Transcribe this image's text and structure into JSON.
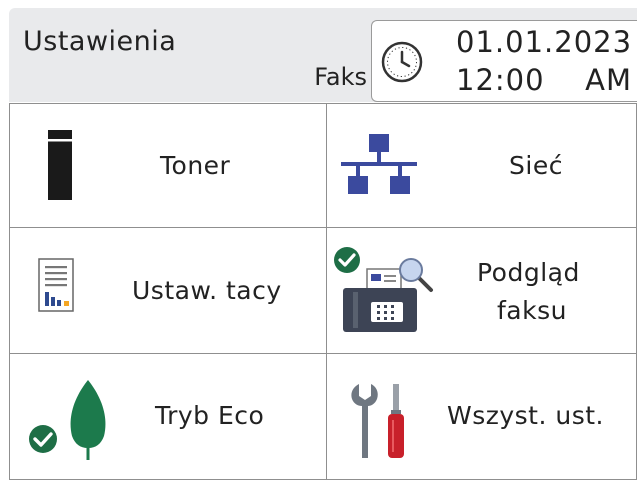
{
  "header": {
    "title": "Ustawienia",
    "mode": "Faks",
    "date": "01.01.2023",
    "time": "12:00",
    "ampm": "AM"
  },
  "tiles": [
    {
      "label": "Toner",
      "icon": "toner-icon"
    },
    {
      "label": "Sieć",
      "icon": "network-icon"
    },
    {
      "label": "Ustaw. tacy",
      "icon": "tray-settings-icon"
    },
    {
      "label_line1": "Podgląd",
      "label_line2": "faksu",
      "icon": "fax-preview-icon"
    },
    {
      "label": "Tryb Eco",
      "icon": "eco-leaf-icon"
    },
    {
      "label": "Wszyst. ust.",
      "icon": "tools-icon"
    }
  ],
  "colors": {
    "header_bg": "#e9eaec",
    "status_green": "#1e6e46",
    "network_blue": "#3b4a9e",
    "leaf_green": "#1c7a4c",
    "fax_dark": "#3d4455",
    "screwdriver_red": "#c8202a"
  }
}
